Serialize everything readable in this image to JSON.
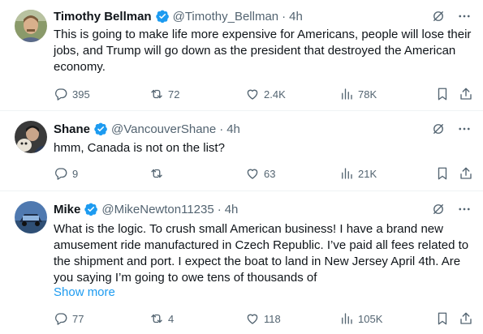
{
  "tweets": [
    {
      "name": "Timothy Bellman",
      "handle": "@Timothy_Bellman",
      "dot": "·",
      "time": "4h",
      "text": "This is going to make life more expensive for Americans, people will lose their jobs, and Trump will go down as the president that destroyed the American economy.",
      "show_more": "",
      "replies": "395",
      "retweets": "72",
      "likes": "2.4K",
      "views": "78K"
    },
    {
      "name": "Shane",
      "handle": "@VancouverShane",
      "dot": "·",
      "time": "4h",
      "text": "hmm, Canada is not on the list?",
      "show_more": "",
      "replies": "9",
      "retweets": "",
      "likes": "63",
      "views": "21K"
    },
    {
      "name": "Mike",
      "handle": "@MikeNewton11235",
      "dot": "·",
      "time": "4h",
      "text": "What is the logic. To crush small American business! I have a brand new amusement ride manufactured in Czech Republic. I’ve paid all fees related to the shipment and port. I expect the boat to land in New Jersey April 4th. Are you saying I’m going to owe tens of thousands of",
      "show_more": "Show more",
      "replies": "77",
      "retweets": "4",
      "likes": "118",
      "views": "105K"
    }
  ],
  "colors": {
    "text": "#0f1419",
    "secondary": "#536471",
    "accent": "#1d9bf0",
    "divider": "#eff3f4"
  },
  "icons": [
    "verified-badge-icon",
    "grok-icon",
    "more-icon",
    "reply-icon",
    "retweet-icon",
    "like-icon",
    "views-icon",
    "bookmark-icon",
    "share-icon"
  ]
}
